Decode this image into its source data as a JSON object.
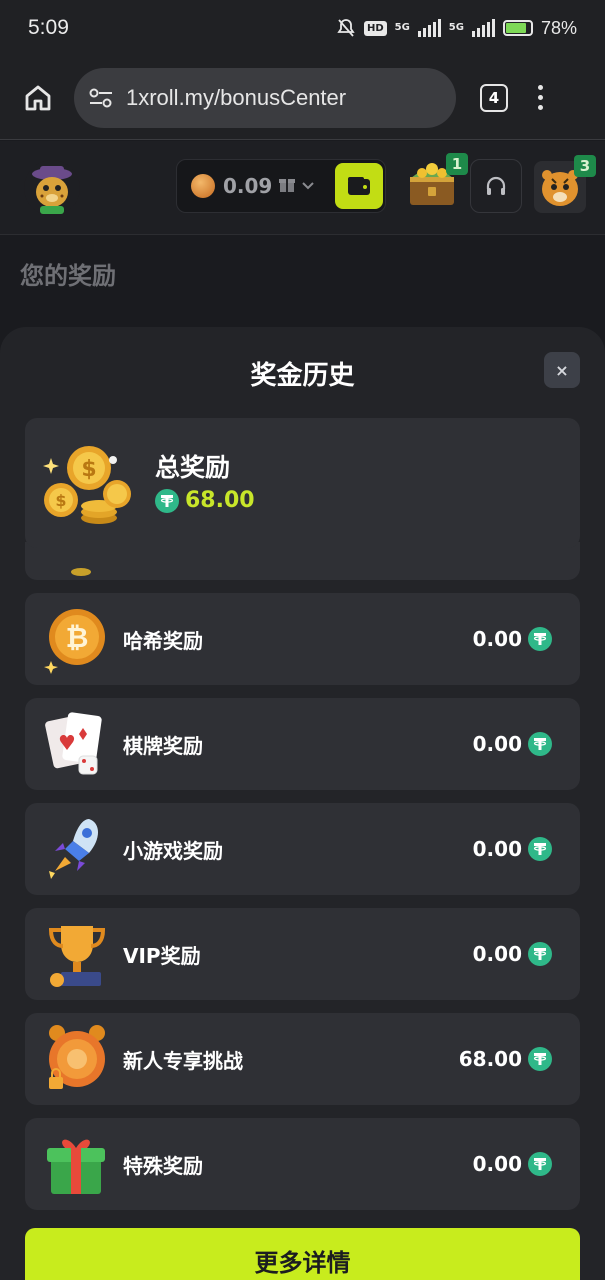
{
  "status_bar": {
    "time": "5:09",
    "network_hd": "HD",
    "net1": "5G",
    "net2": "5G",
    "battery": "78%"
  },
  "browser": {
    "url": "1xroll.my/bonusCenter",
    "tab_count": "4"
  },
  "header": {
    "balance": "0.09",
    "chest_badge": "1",
    "avatar_badge": "3"
  },
  "page": {
    "behind_title": "您的奖励"
  },
  "modal": {
    "title": "奖金历史",
    "close_label": "×",
    "total": {
      "label": "总奖励",
      "amount": "68.00"
    },
    "rows": [
      {
        "label": "哈希奖励",
        "value": "0.00",
        "icon": "bitcoin-coin-icon"
      },
      {
        "label": "棋牌奖励",
        "value": "0.00",
        "icon": "playing-cards-icon"
      },
      {
        "label": "小游戏奖励",
        "value": "0.00",
        "icon": "rocket-icon"
      },
      {
        "label": "VIP奖励",
        "value": "0.00",
        "icon": "trophy-icon"
      },
      {
        "label": "新人专享挑战",
        "value": "68.00",
        "icon": "locked-coin-icon"
      },
      {
        "label": "特殊奖励",
        "value": "0.00",
        "icon": "gift-box-icon"
      }
    ],
    "more_button": "更多详情"
  },
  "colors": {
    "accent": "#c8ec1d",
    "amount_green": "#c8e62a",
    "tether": "#2fb889",
    "card": "#2f3035",
    "modal_bg": "#232428"
  }
}
